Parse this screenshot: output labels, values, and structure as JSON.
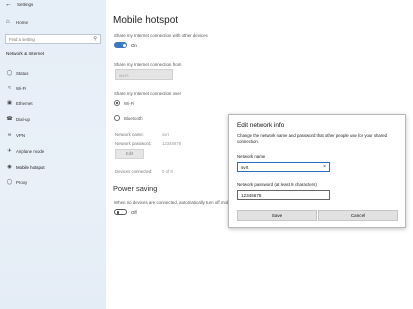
{
  "window": {
    "title": "Settings"
  },
  "sidebar": {
    "home_label": "Home",
    "search_placeholder": "Find a setting",
    "section_heading": "Network & Internet",
    "items": [
      {
        "label": "Status",
        "icon": "globe-icon"
      },
      {
        "label": "Wi-Fi",
        "icon": "wifi-icon"
      },
      {
        "label": "Ethernet",
        "icon": "ethernet-icon"
      },
      {
        "label": "Dial-up",
        "icon": "dialup-icon"
      },
      {
        "label": "VPN",
        "icon": "vpn-icon"
      },
      {
        "label": "Airplane mode",
        "icon": "airplane-icon"
      },
      {
        "label": "Mobile hotspot",
        "icon": "hotspot-icon"
      },
      {
        "label": "Proxy",
        "icon": "globe-icon"
      }
    ]
  },
  "main": {
    "title": "Mobile hotspot",
    "share_label": "Share my Internet connection with other devices",
    "share_toggle_text": "On",
    "share_from_label": "Share my Internet connection from",
    "share_from_value": "Wi-Fi",
    "share_over_label": "Share my Internet connection over",
    "share_over_options": [
      "Wi-Fi",
      "Bluetooth"
    ],
    "network_name_label": "Network name:",
    "network_name_value": "svrt",
    "network_password_label": "Network password:",
    "network_password_value": "12345678",
    "edit_button": "Edit",
    "devices_label": "Devices connected:",
    "devices_value": "0 of 8",
    "power_saving_heading": "Power saving",
    "power_saving_desc": "When no devices are connected, automatically turn off mobile hotspot",
    "power_toggle_text": "Off"
  },
  "dialog": {
    "title": "Edit network info",
    "description": "Change the network name and password that other people use for your shared connection.",
    "name_label": "Network name",
    "name_value": "svrt",
    "password_label": "Network password (at least 8 characters)",
    "password_value": "12345678",
    "save_button": "Save",
    "cancel_button": "Cancel"
  },
  "colors": {
    "accent": "#3b78c4",
    "sidebar_bg": "#e6eef7"
  }
}
